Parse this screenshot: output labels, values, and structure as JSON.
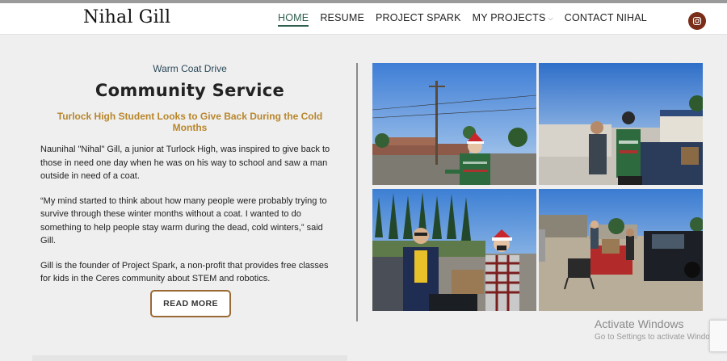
{
  "site": {
    "logo": "Nihal Gill",
    "nav": [
      {
        "label": "HOME",
        "active": true
      },
      {
        "label": "RESUME",
        "active": false
      },
      {
        "label": "PROJECT SPARK",
        "active": false
      },
      {
        "label": "MY PROJECTS",
        "active": false,
        "has_dropdown": true
      },
      {
        "label": "CONTACT NIHAL",
        "active": false
      }
    ],
    "social_icon": "instagram-icon",
    "accent_color": "#2e5e4e"
  },
  "article": {
    "eyebrow": "Warm Coat Drive",
    "title": "Community Service",
    "subtitle": "Turlock High Student Looks to Give Back During the Cold Months",
    "paragraphs": [
      "Naunihal \"Nihal\" Gill, a junior at Turlock High, was inspired to give back to those in need one day when he was on his way to school and saw a man outside in need of a coat.",
      "“My mind started to think about how many people were probably trying to survive through these winter months without a coat. I wanted to do something to help people stay warm during the dead, cold winters,” said Gill.",
      "Gill is the founder of Project Spark, a non-profit that provides free classes for kids in the Ceres community about STEM and robotics."
    ],
    "button_label": "READ MORE"
  },
  "gallery": {
    "photos": [
      "street-photo",
      "truck-photo",
      "parking-lot-photo",
      "tables-photo"
    ]
  },
  "os_overlay": {
    "line1": "Activate Windows",
    "line2": "Go to Settings to activate Windows."
  }
}
